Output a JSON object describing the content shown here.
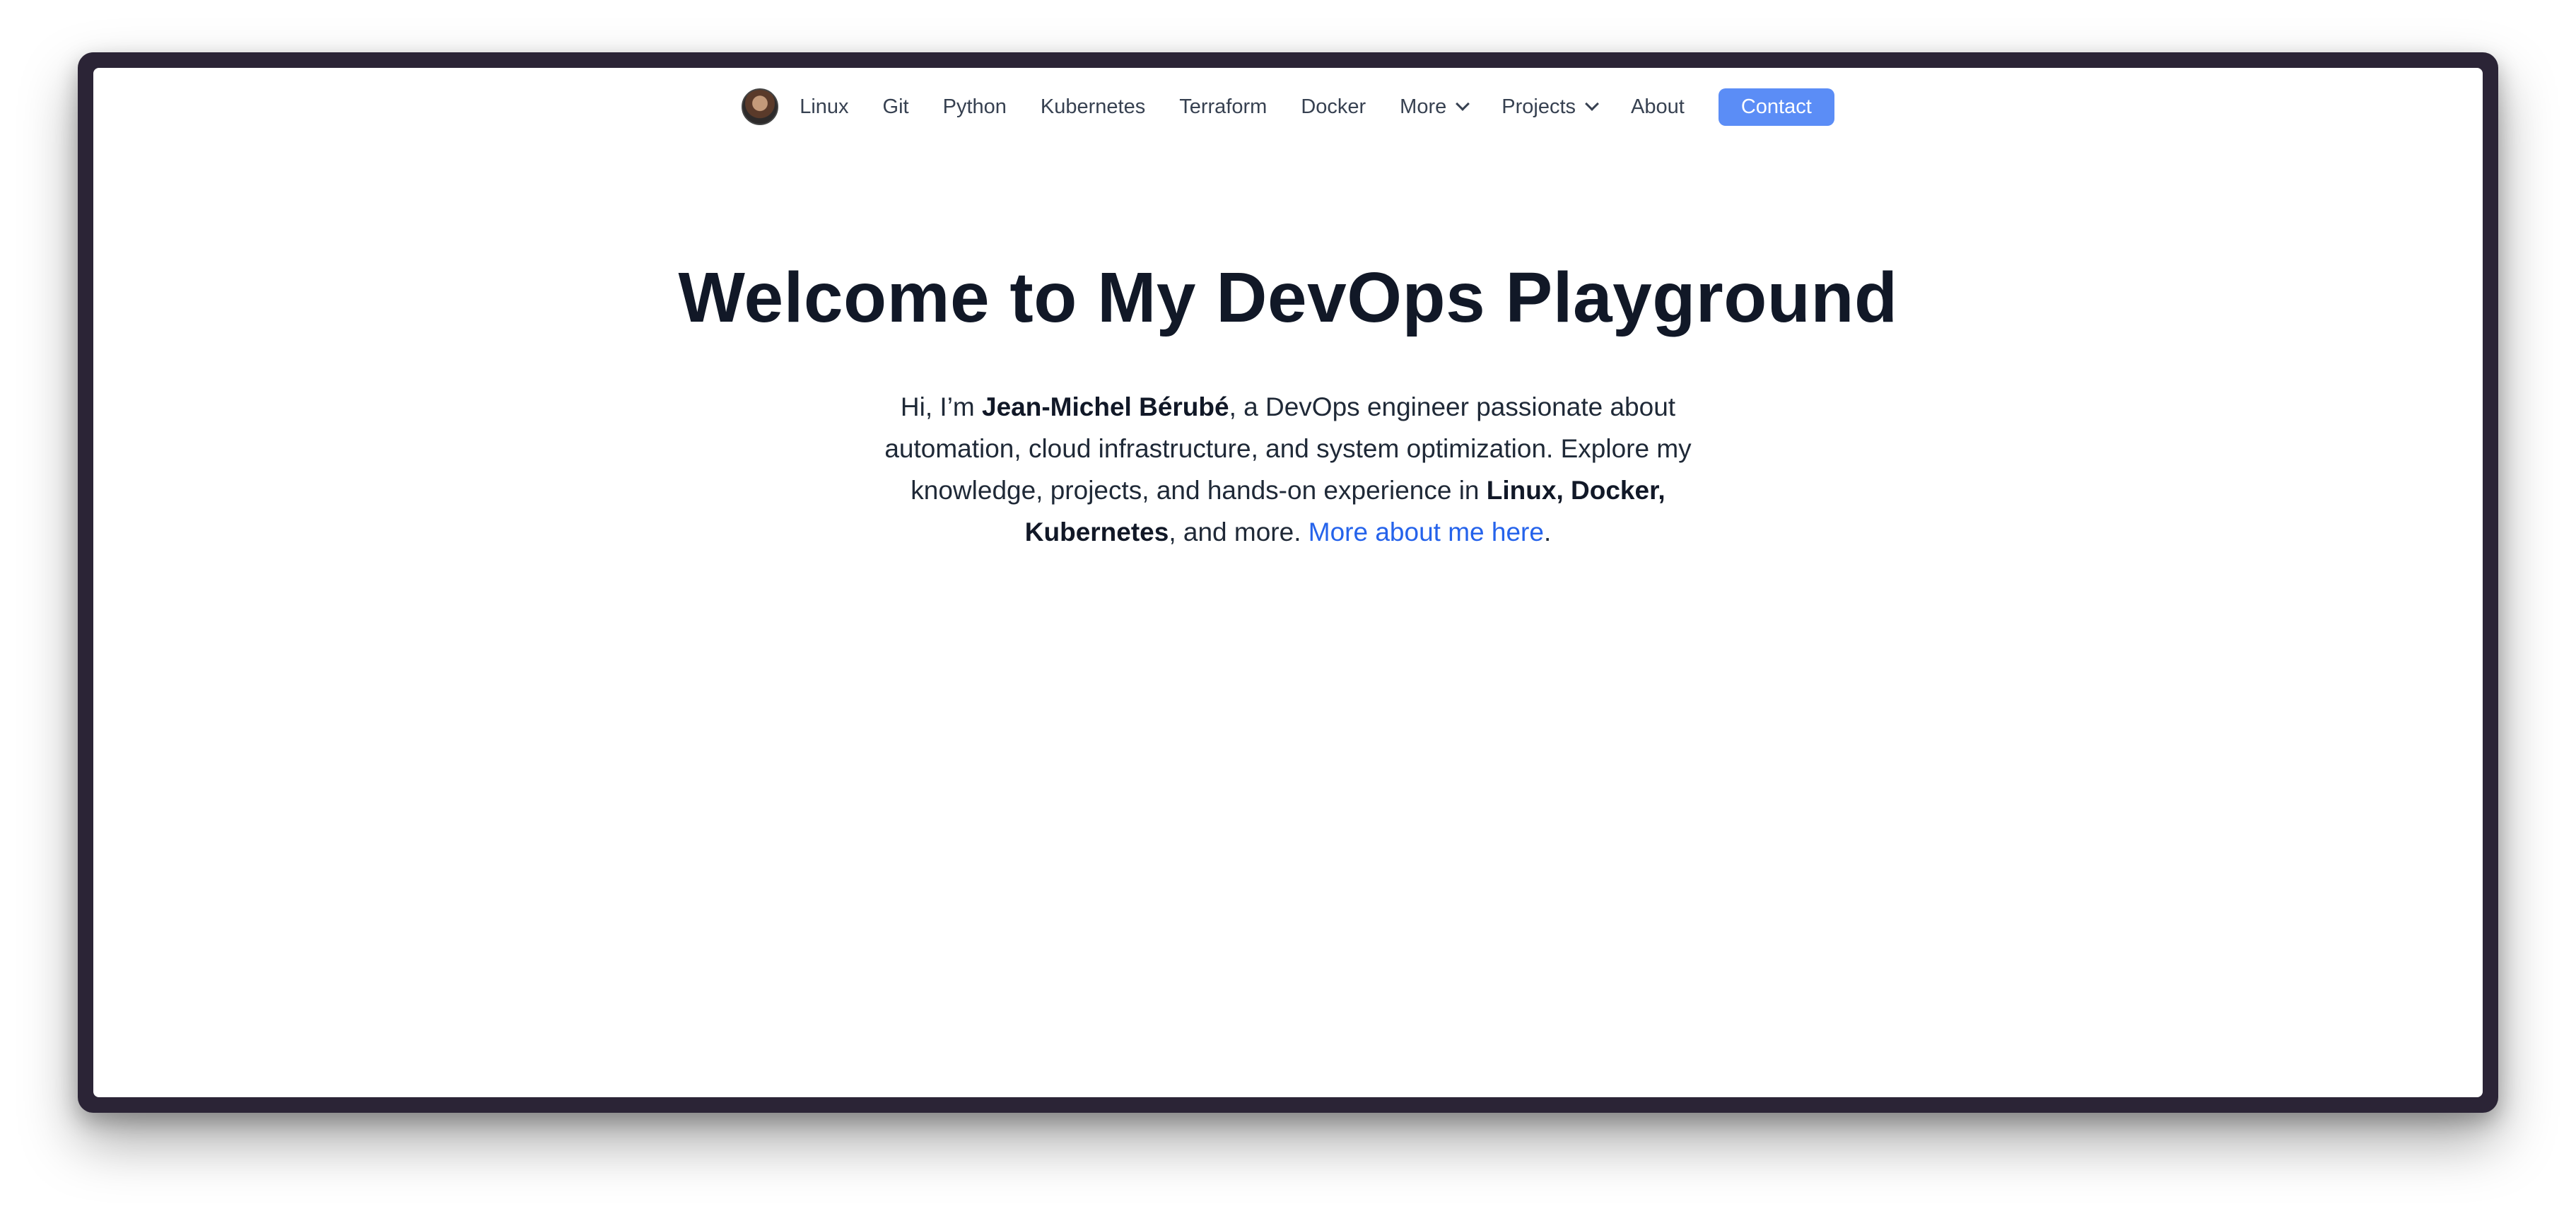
{
  "nav": {
    "items": [
      {
        "label": "Linux"
      },
      {
        "label": "Git"
      },
      {
        "label": "Python"
      },
      {
        "label": "Kubernetes"
      },
      {
        "label": "Terraform"
      },
      {
        "label": "Docker"
      }
    ],
    "more_label": "More",
    "projects_label": "Projects",
    "about_label": "About",
    "contact_label": "Contact"
  },
  "hero": {
    "title": "Welcome to My DevOps Playground",
    "intro_prefix": "Hi, I’m ",
    "name": "Jean-Michel Bérubé",
    "intro_middle": ", a DevOps engineer passionate about automation, cloud infrastructure, and system optimization. Explore my knowledge, projects, and hands-on experience in ",
    "skills": "Linux, Docker, Kubernetes",
    "intro_suffix": ", and more. ",
    "more_link": "More about me here",
    "end_period": "."
  },
  "colors": {
    "accent": "#5b8df6",
    "link": "#2563eb",
    "frame": "#2b2436"
  },
  "icons": {
    "avatar": "profile-photo",
    "dropdown": "chevron-down-icon"
  }
}
